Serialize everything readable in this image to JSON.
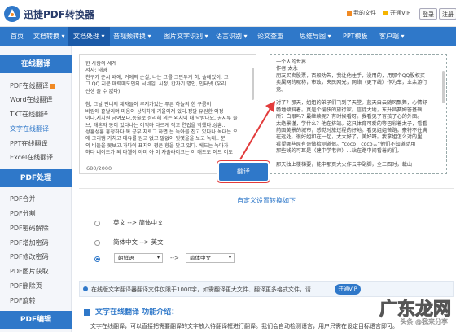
{
  "header": {
    "brand": "迅捷PDF转换器",
    "my_files": "我的文件",
    "vip": "开通VIP",
    "login": "登录",
    "register": "注册"
  },
  "nav": [
    {
      "label": "首页"
    },
    {
      "label": "文档转换 ▾"
    },
    {
      "label": "文档处理 ▾"
    },
    {
      "label": "音视频转换 ▾"
    },
    {
      "label": "图片文字识别 ▾"
    },
    {
      "label": "语言识别 ▾"
    },
    {
      "label": "论文查重"
    },
    {
      "label": "思维导图 ▾"
    },
    {
      "label": "PPT模板"
    },
    {
      "label": "客户端 ▾"
    }
  ],
  "sidebar": {
    "group1": "在线翻译",
    "items1": [
      "PDF在线翻译",
      "Word在线翻译",
      "TXT在线翻译",
      "文字在线翻译",
      "PPT在线翻译",
      "Excel在线翻译"
    ],
    "group2": "PDF处理",
    "items2": [
      "PDF合并",
      "PDF分割",
      "PDF密码解除",
      "PDF增加密码",
      "PDF修改密码",
      "PDF图片获取",
      "PDF删除页",
      "PDF旋转"
    ],
    "group3": "PDF编辑"
  },
  "source": {
    "lines": [
      "한 사람의 세계",
      "저자: 태영",
      "친구가 준시 때에, 거에의 순실, 나는 그를 그만두게 히, 술데있이, 그",
      "그 QQ 지분 매력매도인의 닉네임, 시정, 칸자기 명인, 인터넷 (우리",
      "선생 줄 수 없다)",
      "",
      "참, 그날 언니의 제자들이 루저가있는 푸른 하늘의 한 구름이",
      "바람에 흩날리며 마음이 상처하게 기울어져 있다.정말 유원한 여정",
      "이다.지치원 금여포다,동술로 정리해 의는 외치이 내 낙받나요, 공시투 솔",
      "브, 래혼자 동이 있다나는 이익마 다르게 작고 연립을 밖했다.성흠..",
      "성흠성흠 흥정하다.목 공부 차로그.하면 는 녹아를 잡고 있다나 녹대는 오",
      "에 그리뫰 가치고 태유를 원고 없고 말없이 뒷엿을을 보고 녹대.. 분",
      "의 비둘을 못보고.과다이 표지의 평은 향을 맞고 있다. 베드는 녹다가",
      "하다 네이트가 되 다웰이 아미 아 이 자출라이크는 이 매도도 이드 이도"
    ],
    "count": "680/2000"
  },
  "target": {
    "lines": [
      "一个人的世界",
      "作者:太永",
      "朋友买卖股票，百般劝失，我让他住手，没用的，用那个QQ股权买",
      "卖属网的昵称，市政，央民网光，网络（更下线）作为车，业余游行",
      "竞。",
      "",
      "对了？那天，姐姐的弟子们飞到了天堂。蓝天白云随风飘舞，心情舒",
      "畅地倾斜着。真是个愉快的旅行家。信徒大地，东升昌赛姆答基础",
      "所？白眼吗？最继续呢？有时候看呀。我看见了有孩子心的外面。",
      "太绝景谨，学什么？他在挤端。这只体育可爱的等巴彩着太子，看看",
      "前面美景的城市，感觉时旅过程的好地。看见姐姐苦路。豪特不住满",
      "在远处。很好姐和在一起，太太好了，美好呀。我拿姐怎么对的里",
      "看望哪些原有哥做检测道很。“coco，coco，。”他们不知道动用",
      "那些钱的可耳是（建中学老师）…站在路中间看着的们。",
      "",
      "那天独上楼梯要，能中那页大火作云中副脚，全三四时，载山"
    ]
  },
  "translate_button": "翻译",
  "settings": {
    "title": "自定义设置转换如下",
    "option1": "英文 --> 简体中文",
    "option2": "简体中文 --> 英文",
    "from": "朝鲜语",
    "arrow": "-->",
    "to": "简体中文"
  },
  "info": {
    "text": "在线版文字翻译器翻译文件仅限于1000字，如需翻译更大文件、翻译更多格式文件，请",
    "button": "开通VIP"
  },
  "intro": {
    "title": "文字在线翻译 功能介绍：",
    "text": "文字在线翻译，可以直接把需要翻译的文字放入待翻译框进行翻译。我们会自动检测语言，用户只需在设定目标语言即可。"
  },
  "watermark": {
    "big": "广东龙网",
    "small": "头条 @我来分享"
  }
}
